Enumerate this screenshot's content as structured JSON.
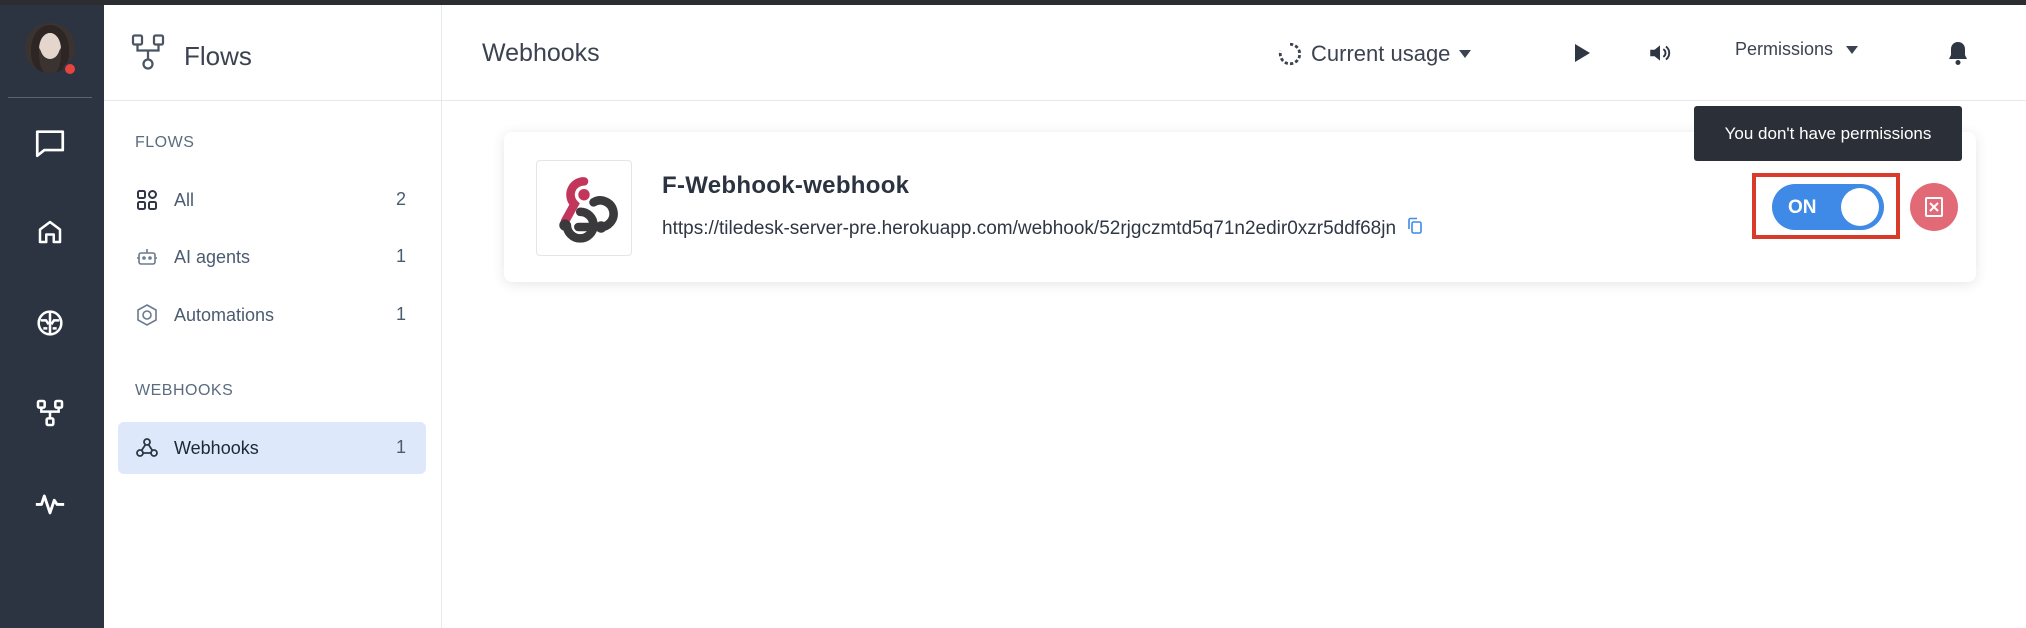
{
  "app": {
    "section_title": "Flows",
    "page_title": "Webhooks"
  },
  "rail": {
    "icons": [
      "chat-icon",
      "home-icon",
      "brain-icon",
      "flows-icon",
      "activity-icon"
    ]
  },
  "sidebar": {
    "group_flows": "FLOWS",
    "items": [
      {
        "label": "All",
        "count": "2",
        "icon": "grid-icon"
      },
      {
        "label": "AI agents",
        "count": "1",
        "icon": "robot-icon"
      },
      {
        "label": "Automations",
        "count": "1",
        "icon": "hexagon-icon"
      }
    ],
    "group_webhooks": "WEBHOOKS",
    "webhooks_item": {
      "label": "Webhooks",
      "count": "1",
      "icon": "webhook-icon"
    }
  },
  "header": {
    "usage_label": "Current usage",
    "permissions_label": "Permissions"
  },
  "webhook": {
    "name": "F-Webhook-webhook",
    "url": "https://tiledesk-server-pre.herokuapp.com/webhook/52rjgczmtd5q71n2edir0xzr5ddf68jn",
    "toggle_label": "ON",
    "enabled": true
  },
  "tooltip": {
    "text": "You don't have permissions"
  },
  "colors": {
    "rail_bg": "#2c3441",
    "accent": "#3f8ae6",
    "danger": "#e26a77",
    "highlight_box": "#d93b2b",
    "active_item_bg": "#dde9fb"
  }
}
